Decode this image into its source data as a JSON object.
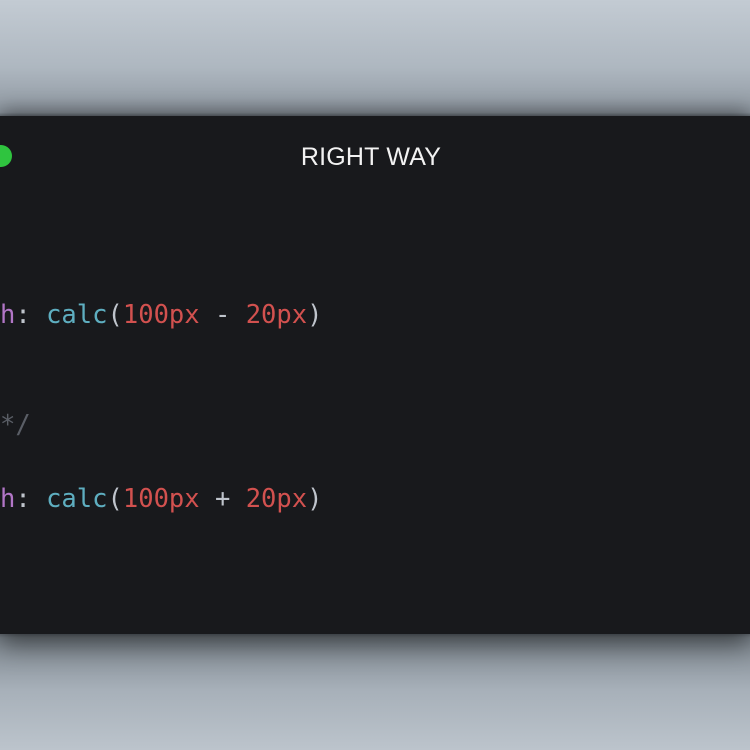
{
  "window": {
    "title": "RIGHT WAY",
    "traffic_light_color": "#2fc43f"
  },
  "code": {
    "line1": {
      "prop": "h",
      "colon": ": ",
      "fn": "calc",
      "open": "(",
      "a": "100px",
      "op": " - ",
      "b": "20px",
      "close": ")"
    },
    "comment": "*/",
    "line2": {
      "prop": "h",
      "colon": ": ",
      "fn": "calc",
      "open": "(",
      "a": "100px",
      "op": " + ",
      "b": "20px",
      "close": ")"
    }
  },
  "colors": {
    "background": "#18191c",
    "property": "#b276c7",
    "function": "#5eaec0",
    "number": "#d2514f",
    "punctuation": "#bfc4cc",
    "comment": "#5a5e66"
  }
}
